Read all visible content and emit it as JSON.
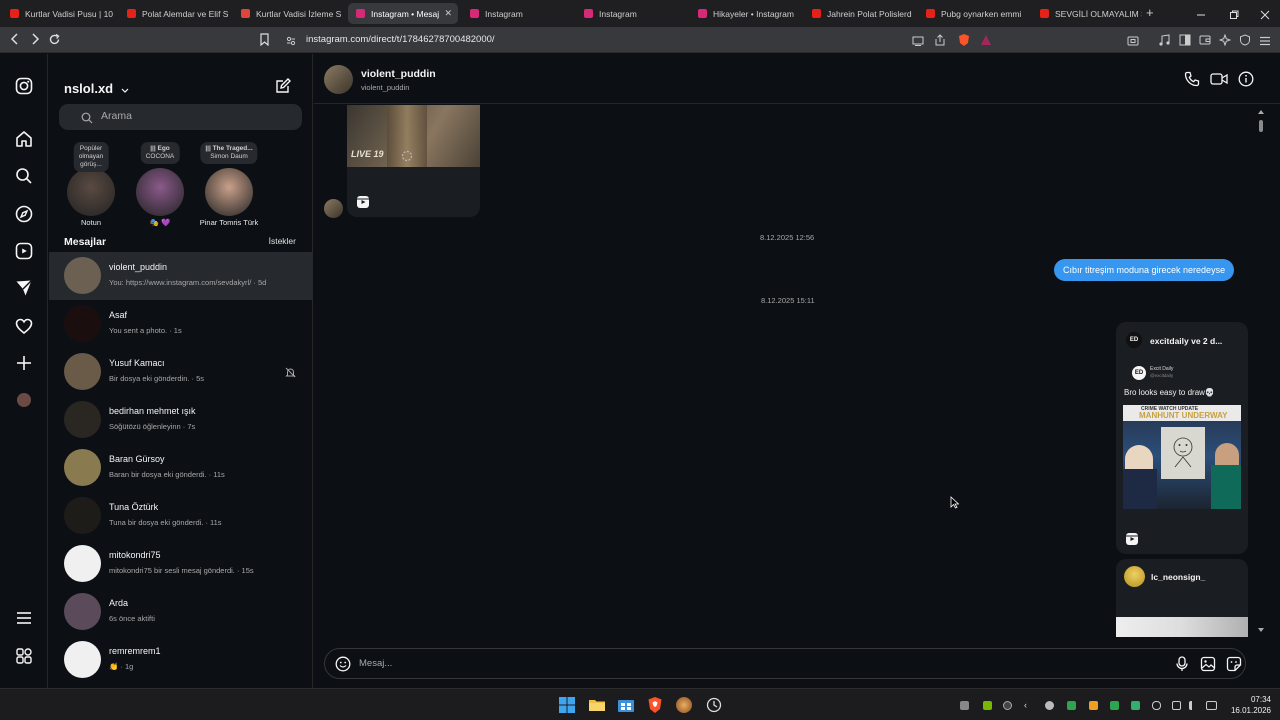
{
  "browser": {
    "tabs": [
      {
        "label": "Kurtlar Vadisi Pusu | 10",
        "favicon_color": "#e62117"
      },
      {
        "label": "Polat Alemdar ve Elif S",
        "favicon_color": "#e62117"
      },
      {
        "label": "Kurtlar Vadisi İzleme S",
        "favicon_color": "#e0453a"
      },
      {
        "label": "Instagram • Mesaj",
        "favicon_color": "#d62976",
        "active": true
      },
      {
        "label": "Instagram",
        "favicon_color": "#d62976"
      },
      {
        "label": "Instagram",
        "favicon_color": "#d62976"
      },
      {
        "label": "Hikayeler • Instagram",
        "favicon_color": "#d62976"
      },
      {
        "label": "Jahrein Polat Polislerd",
        "favicon_color": "#e62117"
      },
      {
        "label": "Pubg oynarken emmi",
        "favicon_color": "#e62117"
      },
      {
        "label": "SEVGİLİ OLMAYALIM Ş",
        "favicon_color": "#e62117"
      }
    ],
    "new_tab": "+",
    "url": "instagram.com/direct/t/17846278700482000/"
  },
  "sidebar": {
    "username": "nslol.xd",
    "search_placeholder": "Arama",
    "notes": [
      {
        "bubble_line1": "Popüler",
        "bubble_line2": "olmayan",
        "bubble_line3": "görüş...",
        "name": "Notun",
        "avatar_color": "#5a4a42"
      },
      {
        "bubble_line1": "||| Ego",
        "bubble_line2": "COCONA",
        "bubble_line3": "",
        "name": "🎭 💜",
        "avatar_color": "#8a5a8a"
      },
      {
        "bubble_line1": "||| The Traged...",
        "bubble_line2": "Simon Daum",
        "bubble_line3": "",
        "name": "Pinar Tomris Türk",
        "avatar_color": "#c9a08a"
      }
    ],
    "messages_heading": "Mesajlar",
    "requests_label": "İstekler",
    "conversations": [
      {
        "name": "violent_puddin",
        "preview": "You: https://www.instagram.com/sevdakyrl/ · 5d",
        "avatar_color": "#6b6052",
        "active": true
      },
      {
        "name": "Asaf",
        "preview": "You sent a photo. · 1s",
        "avatar_color": "#1a0e0e"
      },
      {
        "name": "Yusuf Kamacı",
        "preview": "Bir dosya eki gönderdin. · 5s",
        "avatar_color": "#6a5a48",
        "muted": true
      },
      {
        "name": "bedirhan mehmet ışık",
        "preview": "Söğütözü öğlenleyinn · 7s",
        "avatar_color": "#2a2622"
      },
      {
        "name": "Baran Gürsoy",
        "preview": "Baran bir dosya eki gönderdi. · 11s",
        "avatar_color": "#8a7a50"
      },
      {
        "name": "Tuna Öztürk",
        "preview": "Tuna bir dosya eki gönderdi. · 11s",
        "avatar_color": "#1e1c18"
      },
      {
        "name": "mitokondri75",
        "preview": "mitokondri75 bir sesli mesaj gönderdi. · 15s",
        "avatar_color": "#f0f0f0"
      },
      {
        "name": "Arda",
        "preview": "6s önce aktifti",
        "avatar_color": "#5a4a5a"
      },
      {
        "name": "remremrem1",
        "preview": "👏 · 1g",
        "avatar_color": "#f0f0f0"
      }
    ]
  },
  "chat": {
    "display_name": "violent_puddin",
    "username": "violent_puddin",
    "reel_overlay_text": "LIVE 19",
    "timestamps": [
      "8.12.2025 12:56",
      "8.12.2025 15:11"
    ],
    "sent_message": "Cıbır titreşim moduna girecek neredeyse",
    "shared_post": {
      "title": "excitdaily ve 2 d...",
      "author": "Excit Daily",
      "author_handle": "@excitdaily",
      "author_badge": "ED",
      "caption": "Bro looks easy to draw💀",
      "thumb_banner_line1": "CRIME WATCH UPDATE",
      "thumb_banner_line2": "MANHUNT UNDERWAY"
    },
    "next_post_author": "lc_neonsign_",
    "composer_placeholder": "Mesaj..."
  },
  "taskbar": {
    "time": "07:34",
    "date": "16.01.2026"
  }
}
